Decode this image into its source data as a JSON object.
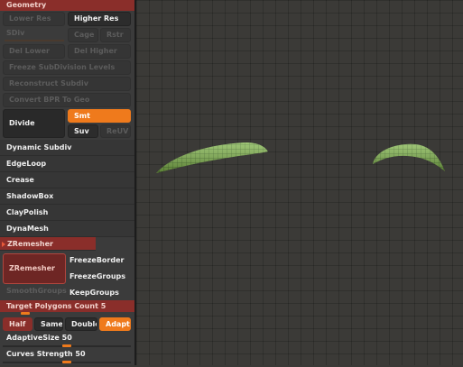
{
  "geometry": {
    "title": "Geometry",
    "lower_res": "Lower Res",
    "higher_res": "Higher Res",
    "sdiv": "SDiv",
    "cage": "Cage",
    "rstr": "Rstr",
    "del_lower": "Del Lower",
    "del_higher": "Del Higher",
    "freeze_subdiv": "Freeze SubDivision Levels",
    "reconstruct_subdiv": "Reconstruct Subdiv",
    "convert_bpr": "Convert BPR To Geo",
    "divide": "Divide",
    "smt": "Smt",
    "suv": "Suv",
    "reuv": "ReUV"
  },
  "menu": {
    "dynamic_subdiv": "Dynamic Subdiv",
    "edgeloop": "EdgeLoop",
    "crease": "Crease",
    "shadowbox": "ShadowBox",
    "claypolish": "ClayPolish",
    "dynamesh": "DynaMesh",
    "zremesher": "ZRemesher"
  },
  "zremesher": {
    "button": "ZRemesher",
    "freeze_border": "FreezeBorder",
    "freeze_groups": "FreezeGroups",
    "smooth_groups": "SmoothGroups",
    "keep_groups": "KeepGroups",
    "target_label": "Target Polygons Count",
    "target_value": "5",
    "target_level": 0.15,
    "half": "Half",
    "same": "Same",
    "double": "Double",
    "adapt": "Adapt",
    "adaptive_label": "AdaptiveSize",
    "adaptive_value": "50",
    "adaptive_level": 0.5,
    "curves_label": "Curves Strength",
    "curves_value": "50",
    "curves_level": 0.5
  },
  "colors": {
    "accent": "#ef7a1c",
    "header": "#8a2e2a",
    "mesh": "#7fb34a"
  }
}
